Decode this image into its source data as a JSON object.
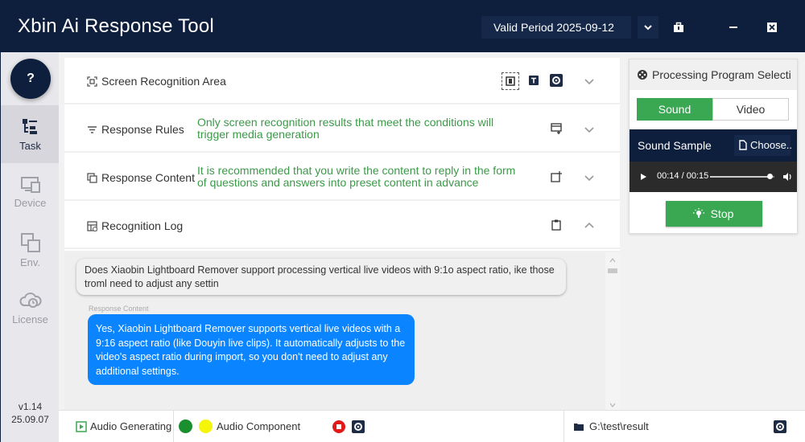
{
  "app": {
    "title": "Xbin Ai Response Tool",
    "valid_period": "Valid Period 2025-09-12"
  },
  "sidebar": {
    "help_label": "?",
    "items": [
      {
        "label": "Task",
        "icon": "task-icon",
        "active": true
      },
      {
        "label": "Device",
        "icon": "device-icon",
        "active": false
      },
      {
        "label": "Env.",
        "icon": "env-icon",
        "active": false
      },
      {
        "label": "License",
        "icon": "license-icon",
        "active": false
      }
    ],
    "version": "v1.14",
    "date": "25.09.07"
  },
  "sections": {
    "screen": {
      "label": "Screen Recognition Area"
    },
    "rules": {
      "label": "Response Rules",
      "desc": "Only screen recognition results that meet the conditions will trigger media generation"
    },
    "content": {
      "label": "Response Content",
      "desc": "It is recommended that you write the content to reply in the form of questions and answers into preset content in advance"
    },
    "log": {
      "label": "Recognition Log"
    }
  },
  "log": {
    "question": "Does Xiaobin Lightboard Remover support processing vertical live videos with 9:1o aspect ratio, ike those troml need to adjust any settin",
    "response_label": "Response Content",
    "answer": "Yes, Xiaobin Lightboard Remover supports vertical live videos with a 9:16 aspect ratio (like Douyin live clips). It automatically adjusts to the video's aspect ratio during import, so you don't need to adjust any additional settings."
  },
  "status": {
    "audio_generating": "Audio Generating",
    "audio_component": "Audio Component",
    "path": "G:\\test\\result"
  },
  "processing": {
    "title": "Processing Program Selecti",
    "tab_sound": "Sound",
    "tab_video": "Video",
    "sound_sample": "Sound Sample",
    "choose": "Choose..",
    "time": "00:14 / 00:15",
    "progress": 0.93,
    "stop": "Stop"
  },
  "colors": {
    "title_bg": "#0e1e3d",
    "accent_green": "#3aa852",
    "desc_green": "#3b9a48",
    "bubble_blue": "#0a84ff"
  }
}
